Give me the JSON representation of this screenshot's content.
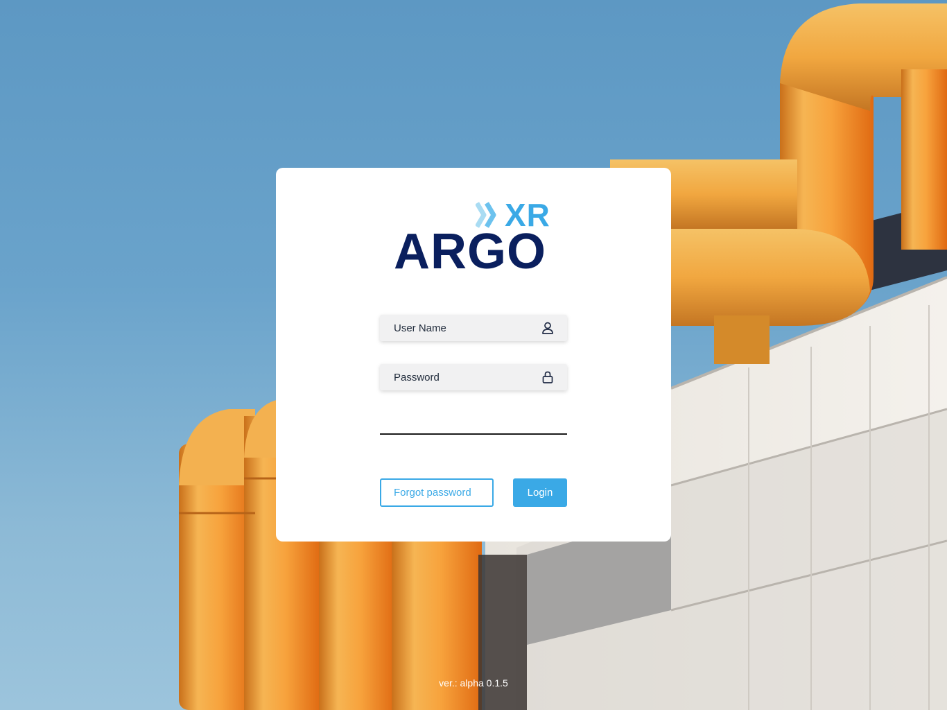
{
  "logo": {
    "top_text": "XR",
    "main_text": "ARGO"
  },
  "form": {
    "username": {
      "placeholder": "User Name",
      "icon": "user-icon"
    },
    "password": {
      "placeholder": "Password",
      "icon": "lock-icon"
    }
  },
  "buttons": {
    "forgot_label": "Forgot password",
    "login_label": "Login"
  },
  "footer": {
    "version": "ver.: alpha 0.1.5"
  },
  "colors": {
    "accent": "#3aa9e6",
    "brand_dark": "#0a1f5e",
    "sky": "#6aa3cb",
    "pipe": "#f2a23a"
  }
}
